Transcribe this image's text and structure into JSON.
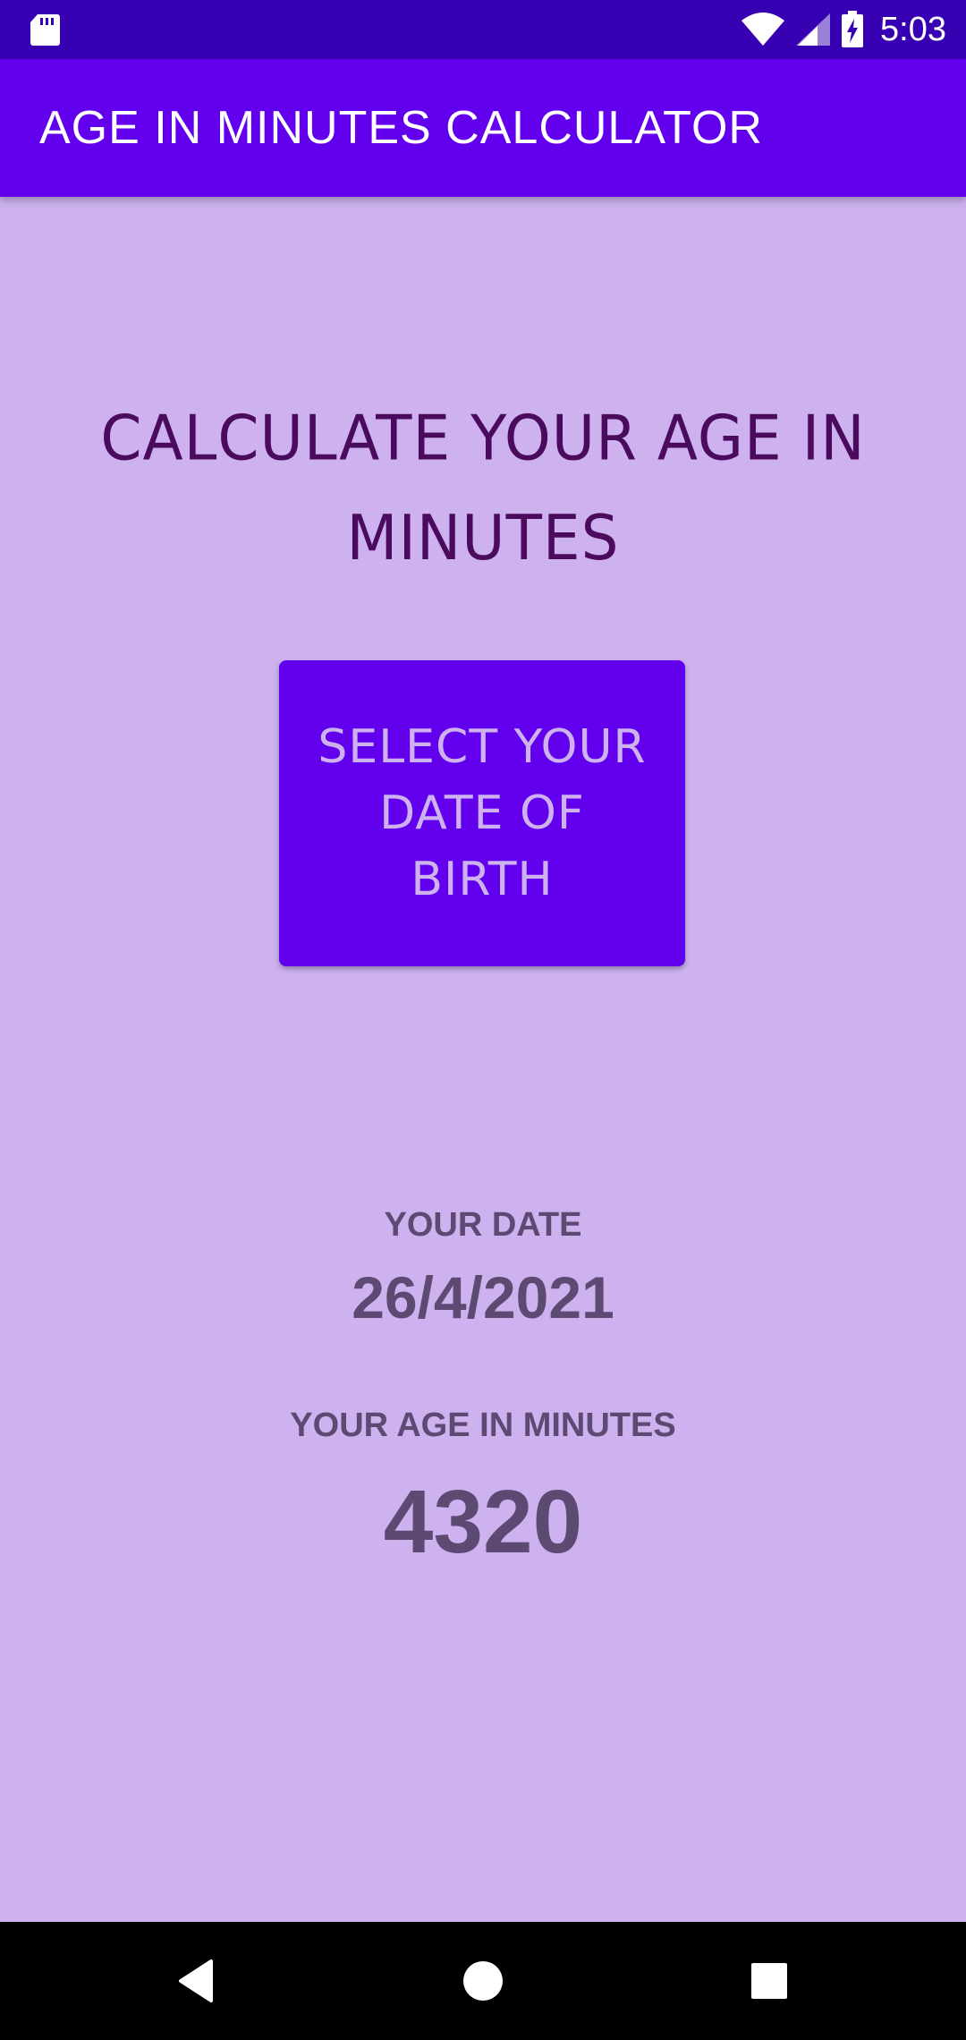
{
  "status_bar": {
    "time": "5:03",
    "icons": [
      "sd-card-icon",
      "wifi-icon",
      "cell-signal-icon",
      "battery-charging-icon"
    ]
  },
  "app_bar": {
    "title": "AGE IN MINUTES CALCULATOR"
  },
  "main": {
    "heading_line1": "CALCULATE YOUR AGE IN",
    "heading_line2": "MINUTES",
    "button": {
      "line1": "SELECT YOUR",
      "line2": "DATE OF",
      "line3": "BIRTH"
    },
    "date_label": "YOUR DATE",
    "date_value": "26/4/2021",
    "age_label": "YOUR AGE IN MINUTES",
    "age_value": "4320"
  },
  "nav_bar": {
    "icons": [
      "back-icon",
      "home-icon",
      "recents-icon"
    ]
  },
  "colors": {
    "status_bar": "#3700b3",
    "app_bar": "#6200ee",
    "background": "#cdb2ef",
    "heading_text": "#4a0a5e",
    "result_text": "#5c4a73",
    "button_text": "#cdb2ef"
  }
}
